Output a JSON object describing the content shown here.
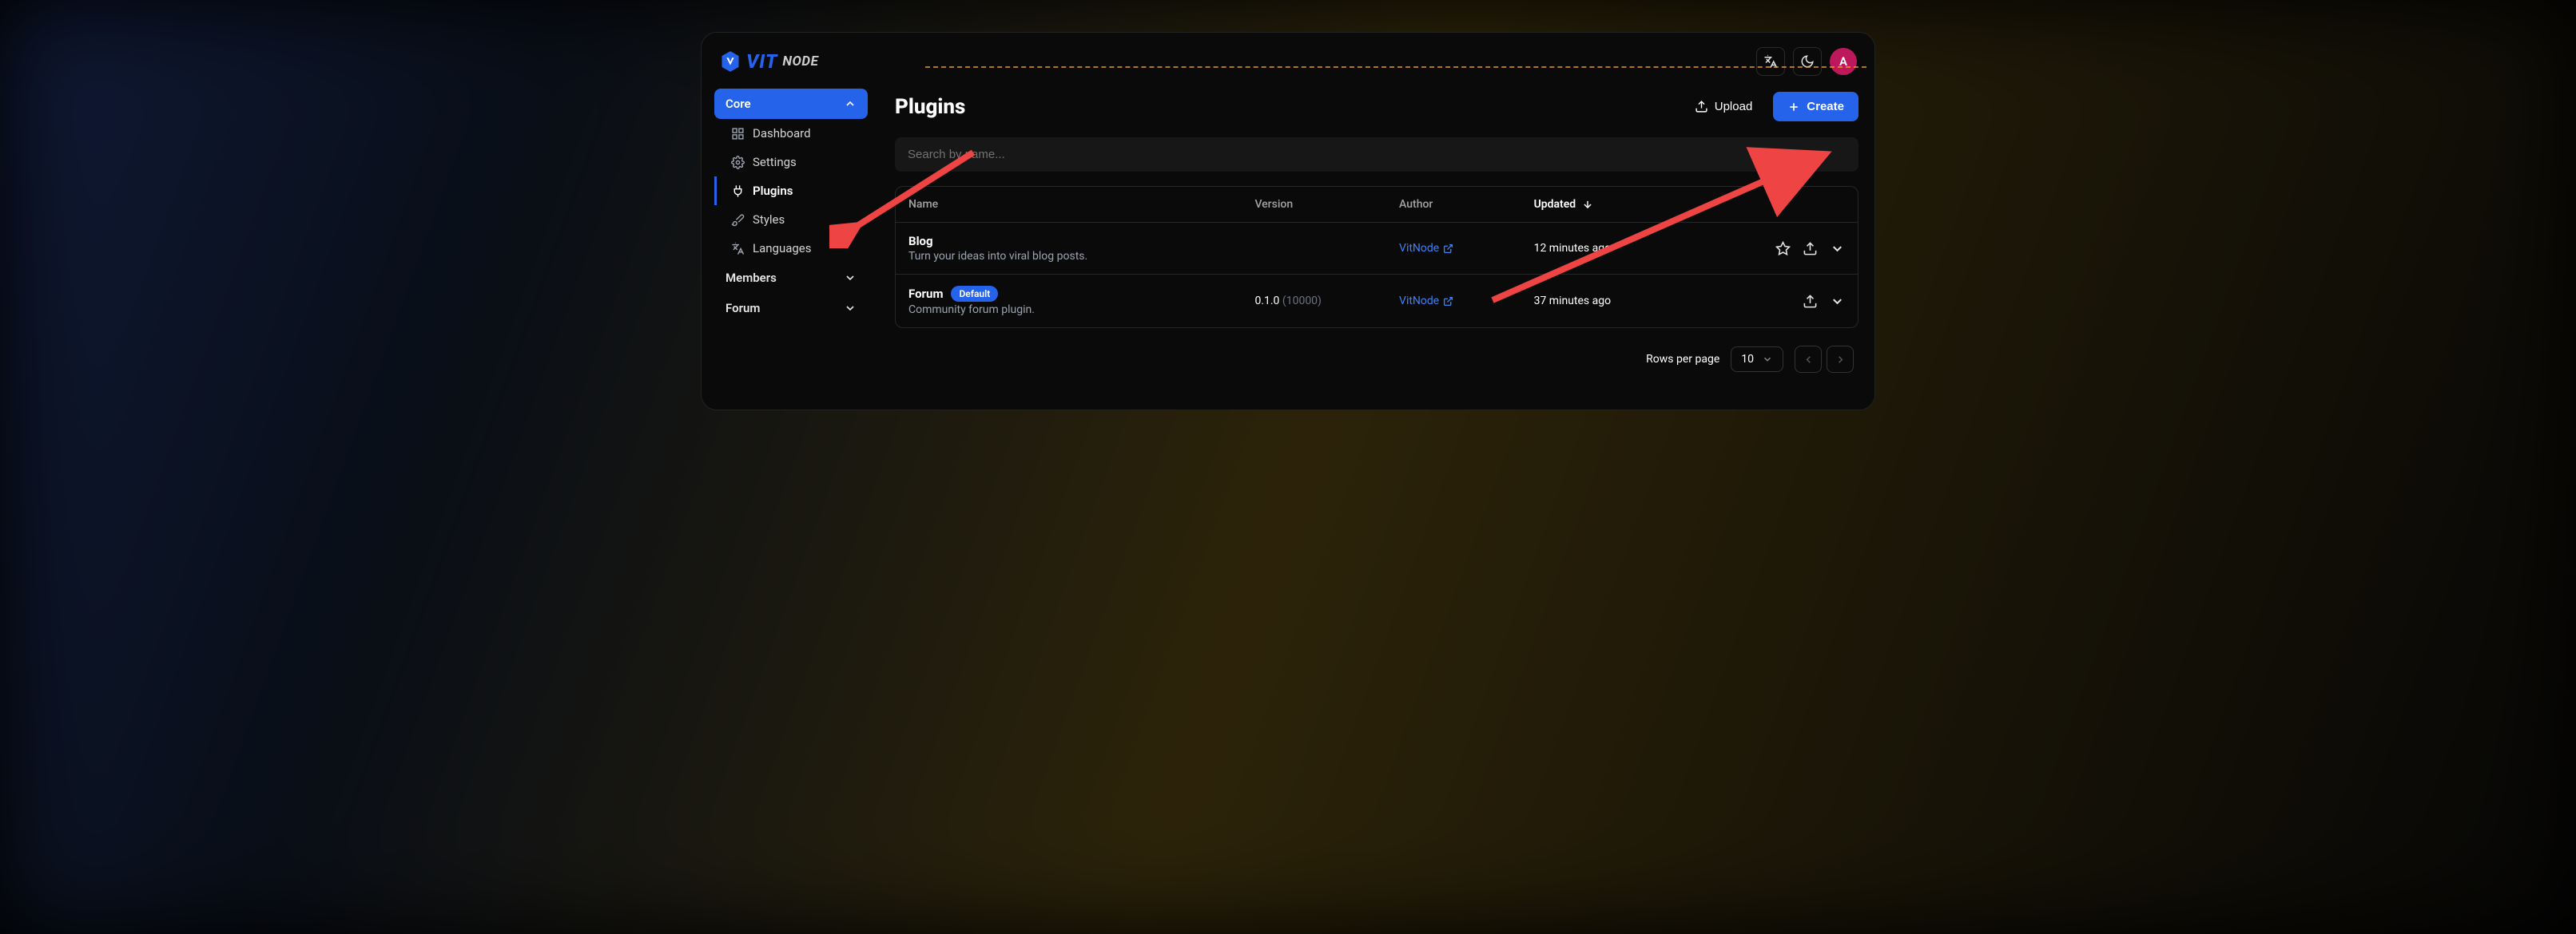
{
  "brand": {
    "vit": "VIT",
    "node": "NODE"
  },
  "avatar_letter": "A",
  "sidebar": {
    "groups": [
      {
        "label": "Core",
        "active": true,
        "expanded": true,
        "items": [
          {
            "label": "Dashboard",
            "icon": "dashboard"
          },
          {
            "label": "Settings",
            "icon": "settings"
          },
          {
            "label": "Plugins",
            "icon": "plug",
            "active": true
          },
          {
            "label": "Styles",
            "icon": "brush"
          },
          {
            "label": "Languages",
            "icon": "translate"
          }
        ]
      },
      {
        "label": "Members",
        "expanded": false
      },
      {
        "label": "Forum",
        "expanded": false
      }
    ]
  },
  "page": {
    "title": "Plugins",
    "upload_label": "Upload",
    "create_label": "Create",
    "search_placeholder": "Search by name..."
  },
  "table": {
    "columns": {
      "name": "Name",
      "version": "Version",
      "author": "Author",
      "updated": "Updated",
      "sort_icon": "down"
    },
    "rows": [
      {
        "name": "Blog",
        "description": "Turn your ideas into viral blog posts.",
        "version": "",
        "version_extra": "",
        "author": "VitNode",
        "updated": "12 minutes ago",
        "default": false,
        "starred": false,
        "actions": [
          "star",
          "upload",
          "more"
        ]
      },
      {
        "name": "Forum",
        "description": "Community forum plugin.",
        "version": "0.1.0",
        "version_extra": "(10000)",
        "author": "VitNode",
        "updated": "37 minutes ago",
        "default": true,
        "default_badge": "Default",
        "actions": [
          "upload",
          "more"
        ]
      }
    ]
  },
  "pagination": {
    "rows_per_page_label": "Rows per page",
    "rows_per_page_value": "10"
  }
}
